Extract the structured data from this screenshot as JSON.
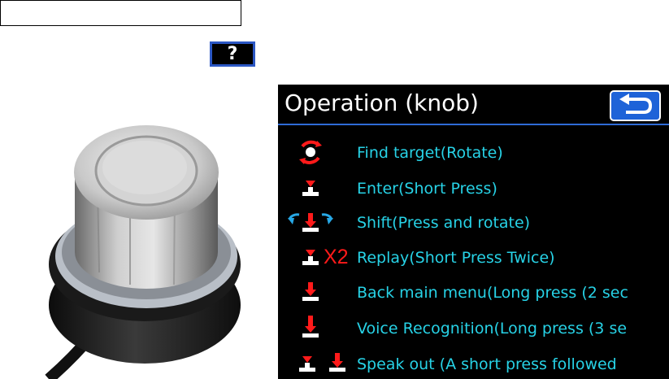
{
  "header": {
    "help_label": "?"
  },
  "panel": {
    "title": "Operation (knob)",
    "items": [
      {
        "label": "Find target(Rotate)"
      },
      {
        "label": "Enter(Short Press)"
      },
      {
        "label": "Shift(Press and rotate)"
      },
      {
        "label": "Replay(Short Press Twice)",
        "badge": "X2"
      },
      {
        "label": "Back main menu(Long press (2 sec"
      },
      {
        "label": "Voice Recognition(Long press (3 se"
      },
      {
        "label": "Speak out (A short press followed"
      }
    ]
  },
  "colors": {
    "accent": "#27d2e6",
    "button_blue": "#1e63d8",
    "icon_red": "#ff1a1a",
    "panel_bg": "#000000"
  }
}
